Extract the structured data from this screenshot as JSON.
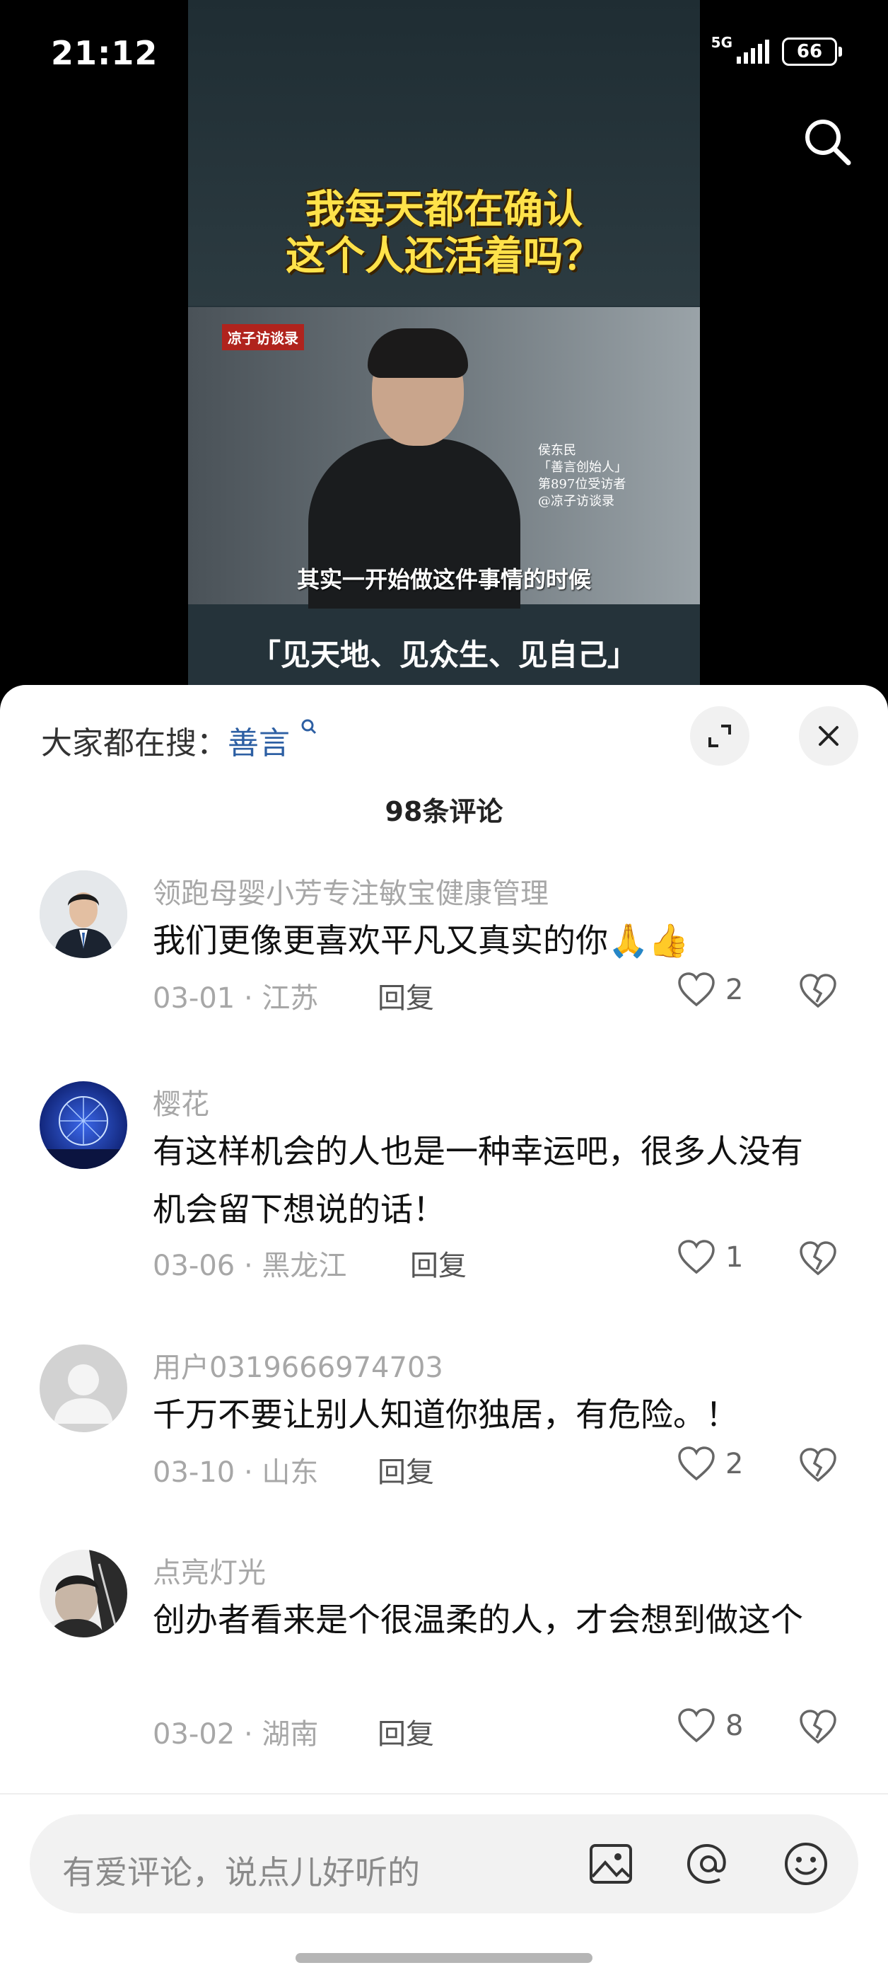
{
  "status_bar": {
    "time": "21:12",
    "network1": "5G",
    "network2": "5G",
    "battery": "66"
  },
  "video": {
    "title_line1": "我每天都在确认",
    "title_line2": "这个人还活着吗？",
    "brand": "凉子访谈录",
    "caption_line1": "侯东民",
    "caption_line2": "「善言创始人」",
    "caption_line3": "第897位受访者",
    "caption_line4": "@凉子访谈录",
    "subtitle": "其实一开始做这件事情的时候",
    "slogan": "「见天地、见众生、见自己」"
  },
  "sheet": {
    "hot_search_prefix": "大家都在搜：",
    "hot_search_keyword": "善言",
    "comment_count": "98条评论"
  },
  "comments": [
    {
      "user": "领跑母婴小芳专注敏宝健康管理",
      "text": "我们更像更喜欢平凡又真实的你🙏👍",
      "date_loc": "03-01 · 江苏",
      "reply": "回复",
      "likes": "2"
    },
    {
      "user": "樱花",
      "text": "有这样机会的人也是一种幸运吧，很多人没有机会留下想说的话！",
      "date_loc": "03-06 · 黑龙江",
      "reply": "回复",
      "likes": "1"
    },
    {
      "user": "用户0319666974703",
      "text": "千万不要让别人知道你独居，有危险。！",
      "date_loc": "03-10 · 山东",
      "reply": "回复",
      "likes": "2"
    },
    {
      "user": "点亮灯光",
      "text": "创办者看来是个很温柔的人，才会想到做这个",
      "date_loc": "03-02 · 湖南",
      "reply": "回复",
      "likes": "8"
    }
  ],
  "input": {
    "placeholder": "有爱评论，说点儿好听的"
  },
  "icons": {
    "search": "search-icon",
    "expand": "expand-icon",
    "close": "close-icon",
    "like": "heart-icon",
    "dislike": "broken-heart-icon",
    "image": "image-icon",
    "mention": "at-icon",
    "emoji": "emoji-icon"
  }
}
